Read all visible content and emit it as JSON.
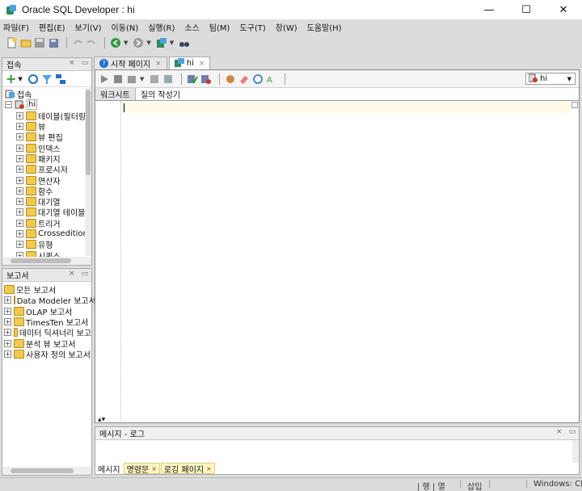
{
  "window": {
    "title": "Oracle SQL Developer : hi",
    "controls": {
      "minimize": "—",
      "maximize": "☐",
      "close": "✕"
    }
  },
  "menu": [
    "파일(F)",
    "편집(E)",
    "보기(V)",
    "이동(N)",
    "실행(R)",
    "소스",
    "팀(M)",
    "도구(T)",
    "창(W)",
    "도움말(H)"
  ],
  "left_top_panel": {
    "title": "접속",
    "root_label": "접속",
    "connection": "hi",
    "items": [
      "테이블(필터링",
      "뷰",
      "뷰 편집",
      "인덱스",
      "패키지",
      "프로시저",
      "연산자",
      "함수",
      "대기열",
      "대기열 테이블",
      "트리거",
      "Crossedition",
      "유형",
      "시퀀스"
    ]
  },
  "left_bottom_panel": {
    "title": "보고서",
    "root_label": "모든 보고서",
    "items": [
      "Data Modeler 보고서",
      "OLAP 보고서",
      "TimesTen 보고서",
      "데이터 딕셔너리 보고",
      "분석 뷰 보고서",
      "사용자 정의 보고서"
    ]
  },
  "doc_tabs": [
    {
      "label": "시작 페이지",
      "active": false
    },
    {
      "label": "hi",
      "active": true
    }
  ],
  "editor": {
    "tabs": [
      "워크시트",
      "질의 작성기"
    ],
    "connection_select": "hi",
    "content": ""
  },
  "bottom_panel": {
    "title": "메시지 - 로그",
    "tabs": [
      "메시지",
      "명령문",
      "로깅 페이지"
    ]
  },
  "status": {
    "row_col": "| 행 | 열",
    "mode": "삽입",
    "os": "Windows: CR"
  },
  "colors": {
    "accent_blue": "#1f6fd0",
    "folder_yellow": "#f2c94c"
  }
}
